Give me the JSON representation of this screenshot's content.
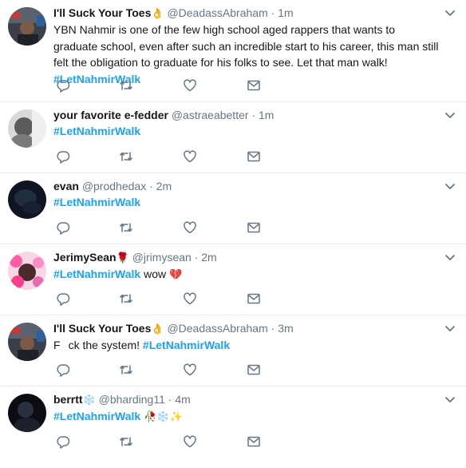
{
  "tweets": [
    {
      "name": "I'll Suck Your Toes",
      "name_emoji": "👌",
      "handle": "@DeadassAbraham",
      "time": "1m",
      "text": "YBN Nahmir is one of the few high school aged rappers that wants to graduate school, even after such an incredible start to his career, this man still felt the obligation to graduate for his folks to see. Let that man walk!",
      "hashtag": "#LetNahmirWalk"
    },
    {
      "name": "your favorite e-fedder",
      "handle": "@astraeabetter",
      "time": "1m",
      "hashtag": "#LetNahmirWalk"
    },
    {
      "name": "evan",
      "handle": "@prodhedax",
      "time": "2m",
      "hashtag": "#LetNahmirWalk"
    },
    {
      "name": "JerimySean",
      "name_emoji": "🌹",
      "handle": "@jrimysean",
      "time": "2m",
      "hashtag": "#LetNahmirWalk",
      "after": "wow",
      "after_emoji": "💔"
    },
    {
      "name": "I'll Suck Your Toes",
      "name_emoji": "👌",
      "handle": "@DeadassAbraham",
      "time": "3m",
      "text_start": "F",
      "text_end": "ck the system!",
      "hashtag": "#LetNahmirWalk"
    },
    {
      "name": "berrtt",
      "name_emoji": "❄️",
      "handle": "@bharding11",
      "time": "4m",
      "hashtag": "#LetNahmirWalk",
      "after_emoji": "🥀❄️✨"
    }
  ],
  "separator": "·",
  "colors": {
    "link": "#1da1f2",
    "secondary_text": "#657786",
    "icon": "#657786",
    "divider": "#e6ecf0"
  }
}
